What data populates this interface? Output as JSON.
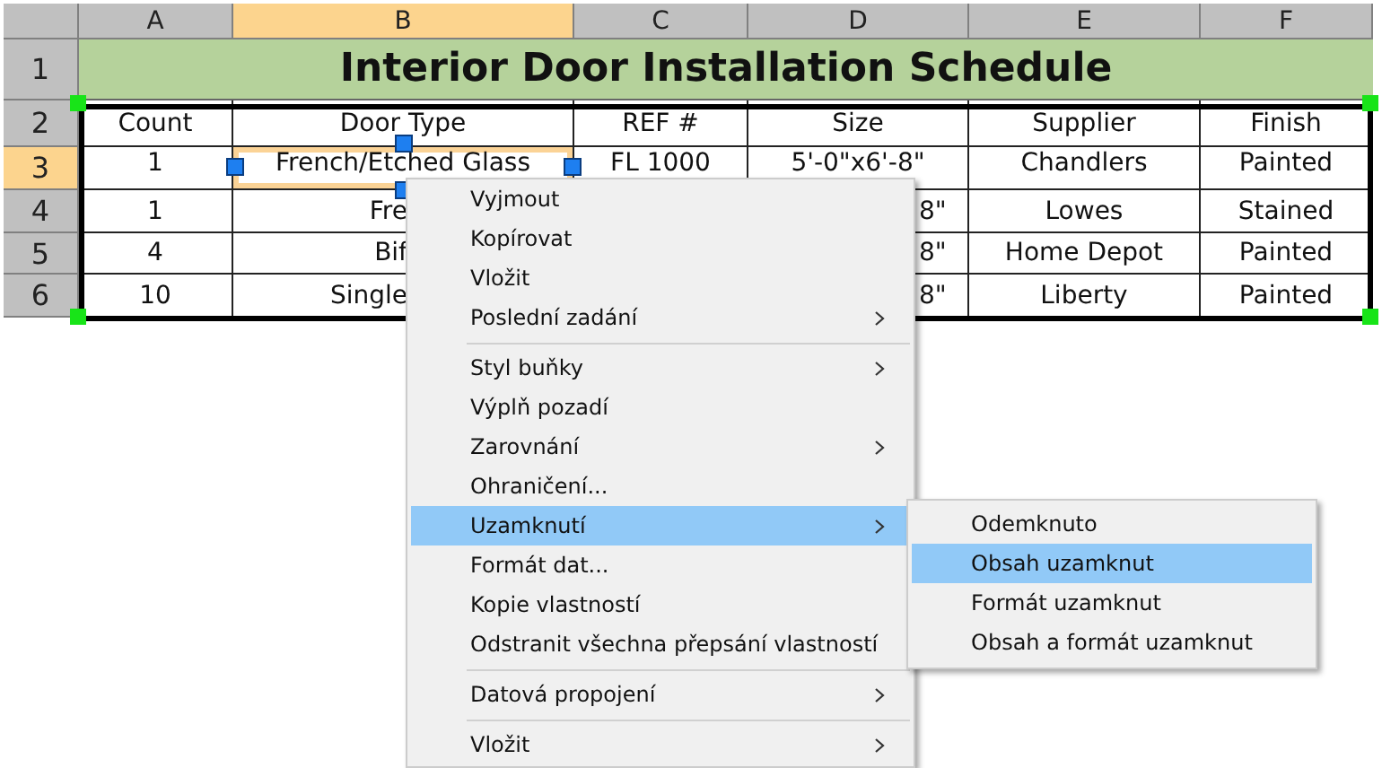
{
  "columns": [
    {
      "label": "A",
      "selected": false
    },
    {
      "label": "B",
      "selected": true
    },
    {
      "label": "C",
      "selected": false
    },
    {
      "label": "D",
      "selected": false
    },
    {
      "label": "E",
      "selected": false
    },
    {
      "label": "F",
      "selected": false
    }
  ],
  "rows": [
    {
      "number": "1",
      "selected": false,
      "kind": "title",
      "title": "Interior Door Installation Schedule"
    },
    {
      "number": "2",
      "selected": false,
      "kind": "data",
      "cells": [
        {
          "text": "Count",
          "kind": "full",
          "selected": false
        },
        {
          "text": "Door Type",
          "kind": "full",
          "selected": false
        },
        {
          "text": "REF #",
          "kind": "full",
          "selected": false
        },
        {
          "text": "Size",
          "kind": "full",
          "selected": false
        },
        {
          "text": "Supplier",
          "kind": "full",
          "selected": false
        },
        {
          "text": "Finish",
          "kind": "full",
          "selected": false
        }
      ]
    },
    {
      "number": "3",
      "selected": true,
      "kind": "data",
      "cells": [
        {
          "text": "1",
          "kind": "full",
          "selected": false
        },
        {
          "text": "French/Etched Glass",
          "kind": "full",
          "selected": true
        },
        {
          "text": "FL 1000",
          "kind": "full",
          "selected": false
        },
        {
          "text": "5'-0\"x6'-8\"",
          "kind": "full",
          "selected": false
        },
        {
          "text": "Chandlers",
          "kind": "full",
          "selected": false
        },
        {
          "text": "Painted",
          "kind": "full",
          "selected": false
        }
      ]
    },
    {
      "number": "4",
      "selected": false,
      "kind": "data",
      "cells": [
        {
          "text": "1",
          "kind": "full",
          "selected": false
        },
        {
          "text": "Fre",
          "kind": "end_hidden",
          "selected": false
        },
        {
          "text": "8\"",
          "kind": "start_hidden",
          "selected": false
        },
        {
          "text": "Lowes",
          "kind": "full",
          "selected": false
        },
        {
          "text": "Stained",
          "kind": "full",
          "selected": false
        }
      ]
    },
    {
      "number": "5",
      "selected": false,
      "kind": "data",
      "cells": [
        {
          "text": "4",
          "kind": "full",
          "selected": false
        },
        {
          "text": "Bif",
          "kind": "end_hidden",
          "selected": false
        },
        {
          "text": "8\"",
          "kind": "start_hidden",
          "selected": false
        },
        {
          "text": "Home Depot",
          "kind": "full",
          "selected": false
        },
        {
          "text": "Painted",
          "kind": "full",
          "selected": false
        }
      ]
    },
    {
      "number": "6",
      "selected": false,
      "kind": "data",
      "cells": [
        {
          "text": "10",
          "kind": "full",
          "selected": false
        },
        {
          "text": "Single",
          "kind": "end_hidden",
          "selected": false
        },
        {
          "text": "8\"",
          "kind": "start_hidden",
          "selected": false
        },
        {
          "text": "Liberty",
          "kind": "full",
          "selected": false
        },
        {
          "text": "Painted",
          "kind": "full",
          "selected": false
        }
      ]
    }
  ],
  "context_menu": {
    "items": [
      {
        "kind": "item",
        "label": "Vyjmout",
        "submenu": false,
        "selected": false
      },
      {
        "kind": "item",
        "label": "Kopírovat",
        "submenu": false,
        "selected": false
      },
      {
        "kind": "item",
        "label": "Vložit",
        "submenu": false,
        "selected": false
      },
      {
        "kind": "item",
        "label": "Poslední zadání",
        "submenu": true,
        "selected": false
      },
      {
        "kind": "separator"
      },
      {
        "kind": "item",
        "label": "Styl buňky",
        "submenu": true,
        "selected": false
      },
      {
        "kind": "item",
        "label": "Výplň pozadí",
        "submenu": false,
        "selected": false
      },
      {
        "kind": "item",
        "label": "Zarovnání",
        "submenu": true,
        "selected": false
      },
      {
        "kind": "item",
        "label": "Ohraničení...",
        "submenu": false,
        "selected": false
      },
      {
        "kind": "item",
        "label": "Uzamknutí",
        "submenu": true,
        "selected": true
      },
      {
        "kind": "item",
        "label": "Formát dat...",
        "submenu": false,
        "selected": false
      },
      {
        "kind": "item",
        "label": "Kopie vlastností",
        "submenu": false,
        "selected": false
      },
      {
        "kind": "item",
        "label": "Odstranit všechna přepsání vlastností",
        "submenu": false,
        "selected": false
      },
      {
        "kind": "separator"
      },
      {
        "kind": "item",
        "label": "Datová propojení",
        "submenu": true,
        "selected": false
      },
      {
        "kind": "separator"
      },
      {
        "kind": "item",
        "label": "Vložit",
        "submenu": true,
        "selected": false
      }
    ]
  },
  "submenu": {
    "items": [
      {
        "label": "Odemknuto",
        "selected": false
      },
      {
        "label": "Obsah uzamknut",
        "selected": true
      },
      {
        "label": "Formát uzamknut",
        "selected": false
      },
      {
        "label": "Obsah a formát uzamknut",
        "selected": false
      }
    ]
  }
}
